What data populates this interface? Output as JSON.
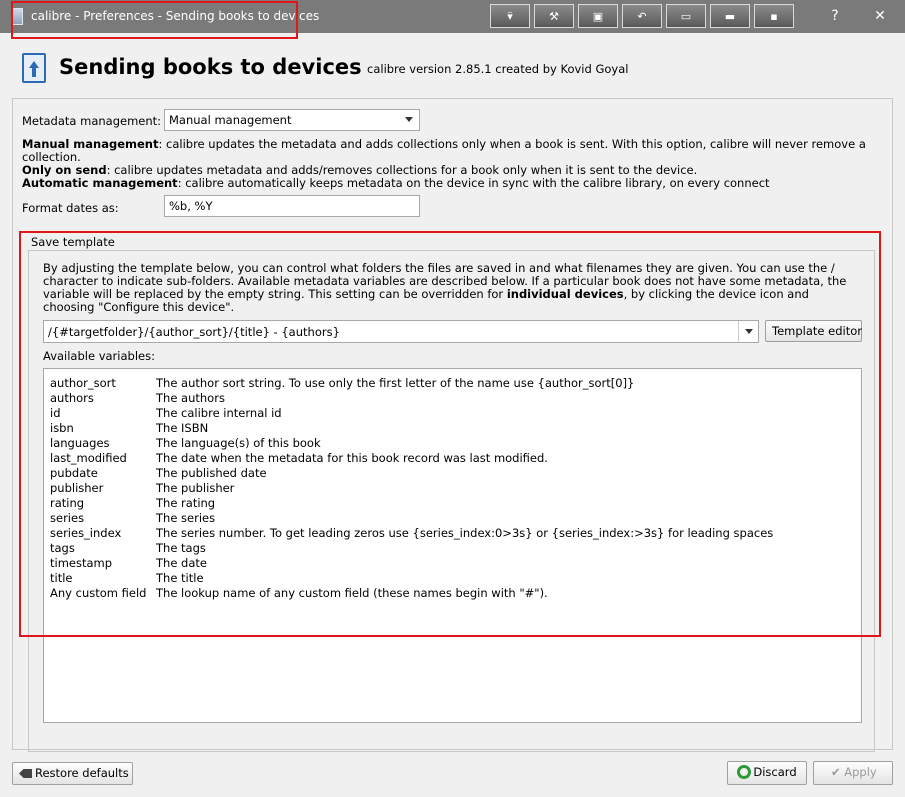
{
  "window": {
    "title": "calibre - Preferences - Sending books to devices",
    "help_label": "?",
    "close_label": "✕"
  },
  "toolbar": {
    "buttons": [
      "▾̈",
      "⚒",
      "▣",
      "↶",
      "▭",
      "▬",
      "▪"
    ]
  },
  "header": {
    "title": "Sending books to devices",
    "version": "calibre version 2.85.1 created by Kovid Goyal"
  },
  "metadata": {
    "label": "Metadata management:",
    "selected": "Manual management",
    "manual_term": "Manual management",
    "manual_desc": ": calibre updates the metadata and adds collections only when a book is sent. With this option, calibre will never remove a collection.",
    "onsend_term": "Only on send",
    "onsend_desc": ": calibre updates metadata and adds/removes collections for a book only when it is sent to the device.",
    "auto_term": "Automatic management",
    "auto_desc": ": calibre automatically keeps metadata on the device in sync with the calibre library, on every connect"
  },
  "format_dates": {
    "label": "Format dates as:",
    "value": "%b, %Y"
  },
  "save_template": {
    "group_title": "Save template",
    "intro_before": "By adjusting the template below, you can control what folders the files are saved in and what filenames they are given. You can use the / character to indicate sub-folders. Available metadata variables are described below. If a particular book does not have some metadata, the variable will be replaced by the empty string. This setting can be overridden for ",
    "intro_bold": "individual devices",
    "intro_after": ", by clicking the device icon and choosing \"Configure this device\".",
    "template_value": "/{#targetfolder}/{author_sort}/{title} - {authors}",
    "editor_button": "Template editor",
    "vars_label": "Available variables:",
    "variables": [
      {
        "name": "author_sort",
        "desc": "The author sort string. To use only the first letter of the name use {author_sort[0]}"
      },
      {
        "name": "authors",
        "desc": "The authors"
      },
      {
        "name": "id",
        "desc": "The calibre internal id"
      },
      {
        "name": "isbn",
        "desc": "The ISBN"
      },
      {
        "name": "languages",
        "desc": "The language(s) of this book"
      },
      {
        "name": "last_modified",
        "desc": "The date when the metadata for this book record was last modified."
      },
      {
        "name": "pubdate",
        "desc": "The published date"
      },
      {
        "name": "publisher",
        "desc": "The publisher"
      },
      {
        "name": "rating",
        "desc": "The rating"
      },
      {
        "name": "series",
        "desc": "The series"
      },
      {
        "name": "series_index",
        "desc": "The series number. To get leading zeros use {series_index:0>3s} or {series_index:>3s} for leading spaces"
      },
      {
        "name": "tags",
        "desc": "The tags"
      },
      {
        "name": "timestamp",
        "desc": "The date"
      },
      {
        "name": "title",
        "desc": "The title"
      },
      {
        "name": "Any custom field",
        "desc": "The lookup name of any custom field (these names begin with \"#\")."
      }
    ]
  },
  "footer": {
    "restore_label": "Restore defaults",
    "discard_label": "Discard",
    "apply_label": "Apply"
  },
  "colors": {
    "titlebar": "#7a7a7a",
    "highlight": "#e0161d"
  }
}
